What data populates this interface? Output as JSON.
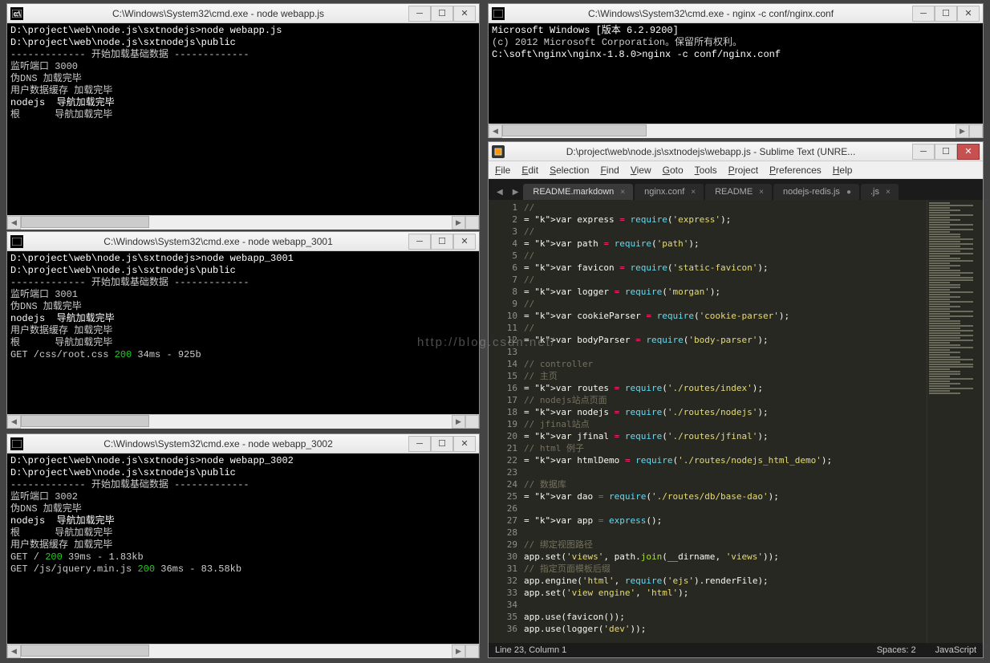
{
  "watermark": "http://blog.csdn.net/",
  "cmd1": {
    "title": "C:\\Windows\\System32\\cmd.exe - node  webapp.js",
    "lines": [
      {
        "t": "D:\\project\\web\\node.js\\sxtnodejs>node webapp.js",
        "cls": "white"
      },
      {
        "t": "D:\\project\\web\\node.js\\sxtnodejs\\public",
        "cls": "white"
      },
      {
        "t": "------------- 开始加载基础数据 -------------",
        "cls": ""
      },
      {
        "t": "监听端口 3000",
        "cls": ""
      },
      {
        "t": "伪DNS 加载完毕",
        "cls": ""
      },
      {
        "t": "用户数据缓存 加载完毕",
        "cls": ""
      },
      {
        "t": "nodejs  导航加载完毕",
        "cls": "white"
      },
      {
        "t": "根      导航加载完毕",
        "cls": ""
      }
    ]
  },
  "cmd2": {
    "title": "C:\\Windows\\System32\\cmd.exe - node  webapp_3001",
    "lines": [
      {
        "t": "D:\\project\\web\\node.js\\sxtnodejs>node webapp_3001",
        "cls": "white"
      },
      {
        "t": "D:\\project\\web\\node.js\\sxtnodejs\\public",
        "cls": "white"
      },
      {
        "t": "------------- 开始加载基础数据 -------------",
        "cls": ""
      },
      {
        "t": "监听端口 3001",
        "cls": ""
      },
      {
        "t": "伪DNS 加载完毕",
        "cls": ""
      },
      {
        "t": "nodejs  导航加载完毕",
        "cls": "white"
      },
      {
        "t": "用户数据缓存 加载完毕",
        "cls": ""
      },
      {
        "t": "根      导航加载完毕",
        "cls": ""
      }
    ],
    "get": {
      "prefix": "GET /css/root.css ",
      "status": "200",
      "rest": " 34ms - 925b"
    }
  },
  "cmd3": {
    "title": "C:\\Windows\\System32\\cmd.exe - node  webapp_3002",
    "lines": [
      {
        "t": "D:\\project\\web\\node.js\\sxtnodejs>node webapp_3002",
        "cls": "white"
      },
      {
        "t": "D:\\project\\web\\node.js\\sxtnodejs\\public",
        "cls": "white"
      },
      {
        "t": "------------- 开始加载基础数据 -------------",
        "cls": ""
      },
      {
        "t": "监听端口 3002",
        "cls": ""
      },
      {
        "t": "伪DNS 加载完毕",
        "cls": ""
      },
      {
        "t": "nodejs  导航加载完毕",
        "cls": "white"
      },
      {
        "t": "根      导航加载完毕",
        "cls": ""
      },
      {
        "t": "用户数据缓存 加载完毕",
        "cls": ""
      }
    ],
    "get1": {
      "prefix": "GET / ",
      "status": "200",
      "rest": " 39ms - 1.83kb"
    },
    "get2": {
      "prefix": "GET /js/jquery.min.js ",
      "status": "200",
      "rest": " 36ms - 83.58kb"
    }
  },
  "nginx": {
    "title": "C:\\Windows\\System32\\cmd.exe - nginx  -c conf/nginx.conf",
    "lines": [
      {
        "t": "Microsoft Windows [版本 6.2.9200]",
        "cls": "white"
      },
      {
        "t": "(c) 2012 Microsoft Corporation。保留所有权利。",
        "cls": ""
      },
      {
        "t": "",
        "cls": ""
      },
      {
        "t": "C:\\soft\\nginx\\nginx-1.8.0>nginx -c conf/nginx.conf",
        "cls": "white"
      }
    ]
  },
  "sublime": {
    "title": "D:\\project\\web\\node.js\\sxtnodejs\\webapp.js - Sublime Text (UNRE...",
    "menus": [
      "File",
      "Edit",
      "Selection",
      "Find",
      "View",
      "Goto",
      "Tools",
      "Project",
      "Preferences",
      "Help"
    ],
    "tabs": [
      {
        "label": "README.markdown",
        "dirty": false
      },
      {
        "label": "nginx.conf",
        "dirty": false
      },
      {
        "label": "README",
        "dirty": false
      },
      {
        "label": "nodejs-redis.js",
        "dirty": true
      },
      {
        "label": ".js",
        "dirty": false
      }
    ],
    "status_left": "Line 23, Column 1",
    "status_spaces": "Spaces: 2",
    "status_lang": "JavaScript",
    "code_lines": [
      "//",
      "var express = require('express');",
      "//",
      "var path = require('path');",
      "//",
      "var favicon = require('static-favicon');",
      "//",
      "var logger = require('morgan');",
      "//",
      "var cookieParser = require('cookie-parser');",
      "//",
      "var bodyParser = require('body-parser');",
      "",
      "// controller",
      "// 主页",
      "var routes = require('./routes/index');",
      "// nodejs站点页面",
      "var nodejs = require('./routes/nodejs');",
      "// jfinal站点",
      "var jfinal = require('./routes/jfinal');",
      "// html 例子",
      "var htmlDemo = require('./routes/nodejs_html_demo');",
      "",
      "// 数据库",
      "var dao = require('./routes/db/base-dao');",
      "",
      "var app = express();",
      "",
      "// 绑定视图路径",
      "app.set('views', path.join(__dirname, 'views'));",
      "// 指定页面模板后缀",
      "app.engine('html', require('ejs').renderFile);",
      "app.set('view engine', 'html');",
      "",
      "app.use(favicon());",
      "app.use(logger('dev'));"
    ],
    "first_line_no": 1,
    "current_line": 23
  }
}
